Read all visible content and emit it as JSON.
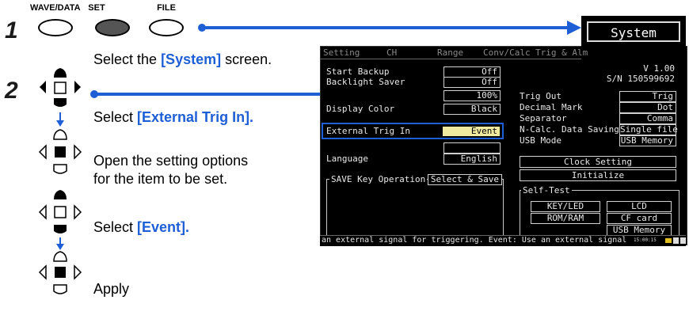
{
  "colors": {
    "accent": "#1e5fd6",
    "screen_bg": "#000000",
    "highlight_fill": "#f0eaa0"
  },
  "step1": {
    "number": "1",
    "keys": [
      "WAVE/DATA",
      "SET",
      "FILE"
    ],
    "instruction_prefix": "Select the ",
    "instruction_highlight": "[System]",
    "instruction_suffix": " screen."
  },
  "step2": {
    "number": "2",
    "rows": [
      {
        "prefix": "Select ",
        "highlight": "[External Trig In].",
        "suffix": ""
      },
      {
        "prefix": "Open the setting options",
        "highlight": "",
        "suffix": ""
      },
      {
        "prefix": "for the item to be set.",
        "highlight": "",
        "suffix": ""
      },
      {
        "prefix": "Select ",
        "highlight": "[Event].",
        "suffix": ""
      },
      {
        "prefix": "Apply",
        "highlight": "",
        "suffix": ""
      }
    ]
  },
  "screen": {
    "system_label": "System",
    "tabs": [
      "Setting",
      "CH",
      "Range",
      "Conv/Calc",
      "Trig & Alm"
    ],
    "version": "V 1.00",
    "serial": "S/N 150599692",
    "left_settings": [
      {
        "label": "Start Backup",
        "value": "Off"
      },
      {
        "label": "Backlight Saver",
        "value": "Off"
      },
      {
        "label": "",
        "value": "100%"
      },
      {
        "label": "Display Color",
        "value": "Black"
      },
      {
        "label": "External Trig In",
        "value": "Event"
      },
      {
        "label": "",
        "value": ""
      },
      {
        "label": "Language",
        "value": "English"
      }
    ],
    "save_key_label": "SAVE Key Operation",
    "save_key_value": "Select & Save",
    "right_settings": [
      {
        "label": "Trig Out",
        "value": "Trig"
      },
      {
        "label": "Decimal Mark",
        "value": "Dot"
      },
      {
        "label": "Separator",
        "value": "Comma"
      },
      {
        "label": "N-Calc. Data Saving",
        "value": "Single file"
      },
      {
        "label": "USB Mode",
        "value": "USB Memory"
      }
    ],
    "clock_setting": "Clock Setting",
    "initialize": "Initialize",
    "self_test_label": "Self-Test",
    "self_test_buttons": [
      "KEY/LED",
      "LCD",
      "ROM/RAM",
      "CF card",
      "USB Memory"
    ],
    "status_text": "an external signal for triggering. Event: Use an external signal",
    "status_time": "15:00:15"
  }
}
